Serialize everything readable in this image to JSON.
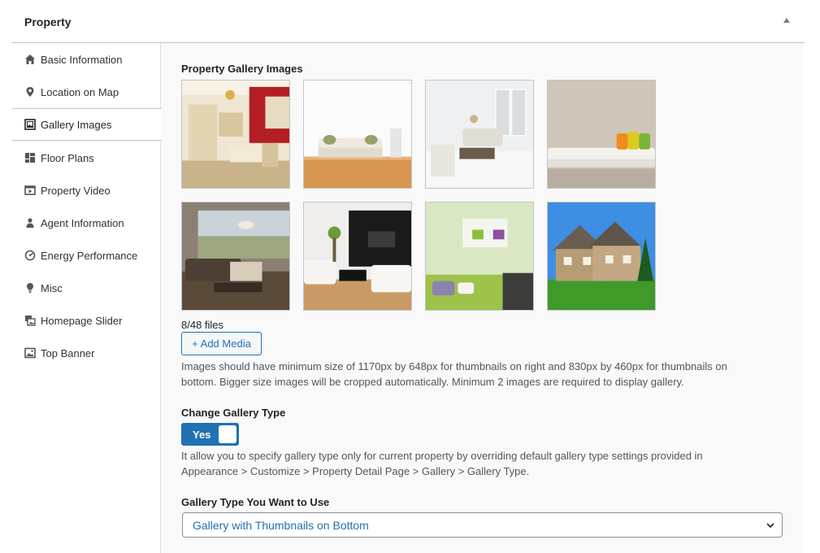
{
  "panel": {
    "title": "Property",
    "collapse_icon": "triangle-up-icon"
  },
  "sidebar": {
    "items": [
      {
        "label": "Basic Information",
        "icon": "home-icon",
        "active": false
      },
      {
        "label": "Location on Map",
        "icon": "map-pin-icon",
        "active": false
      },
      {
        "label": "Gallery Images",
        "icon": "gallery-icon",
        "active": true
      },
      {
        "label": "Floor Plans",
        "icon": "floor-plan-icon",
        "active": false
      },
      {
        "label": "Property Video",
        "icon": "video-icon",
        "active": false
      },
      {
        "label": "Agent Information",
        "icon": "person-icon",
        "active": false
      },
      {
        "label": "Energy Performance",
        "icon": "energy-icon",
        "active": false
      },
      {
        "label": "Misc",
        "icon": "lightbulb-icon",
        "active": false
      },
      {
        "label": "Homepage Slider",
        "icon": "slides-icon",
        "active": false
      },
      {
        "label": "Top Banner",
        "icon": "image-icon",
        "active": false
      }
    ]
  },
  "gallery": {
    "label": "Property Gallery Images",
    "images": [
      {
        "subject": "kitchen with red wall and chandelier"
      },
      {
        "subject": "white sofa on wooden floor"
      },
      {
        "subject": "bright living room with white floor"
      },
      {
        "subject": "white sofa with colorful pillows"
      },
      {
        "subject": "living room with brown sectional sofa"
      },
      {
        "subject": "modern living room with white sofas"
      },
      {
        "subject": "green room with wall shelves"
      },
      {
        "subject": "stone house exterior with lawn"
      }
    ],
    "files_count": "8/48 files",
    "add_media_label": "+ Add Media",
    "help_line1": "Images should have minimum size of 1170px by 648px for thumbnails on right and 830px by 460px for thumbnails on",
    "help_line2": "bottom. Bigger size images will be cropped automatically. Minimum 2 images are required to display gallery."
  },
  "gallery_type_toggle": {
    "label": "Change Gallery Type",
    "value": "Yes",
    "help_line1": "It allow you to specify gallery type only for current property by overriding default gallery type settings provided in",
    "help_line2": "Appearance > Customize > Property Detail Page > Gallery > Gallery Type."
  },
  "gallery_type_select": {
    "label": "Gallery Type You Want to Use",
    "selected": "Gallery with Thumbnails on Bottom",
    "chevron_icon": "chevron-down-icon"
  },
  "colors": {
    "accent": "#2271b1",
    "text": "#1d2327",
    "muted": "#50575e",
    "border": "#c3c4c7"
  }
}
